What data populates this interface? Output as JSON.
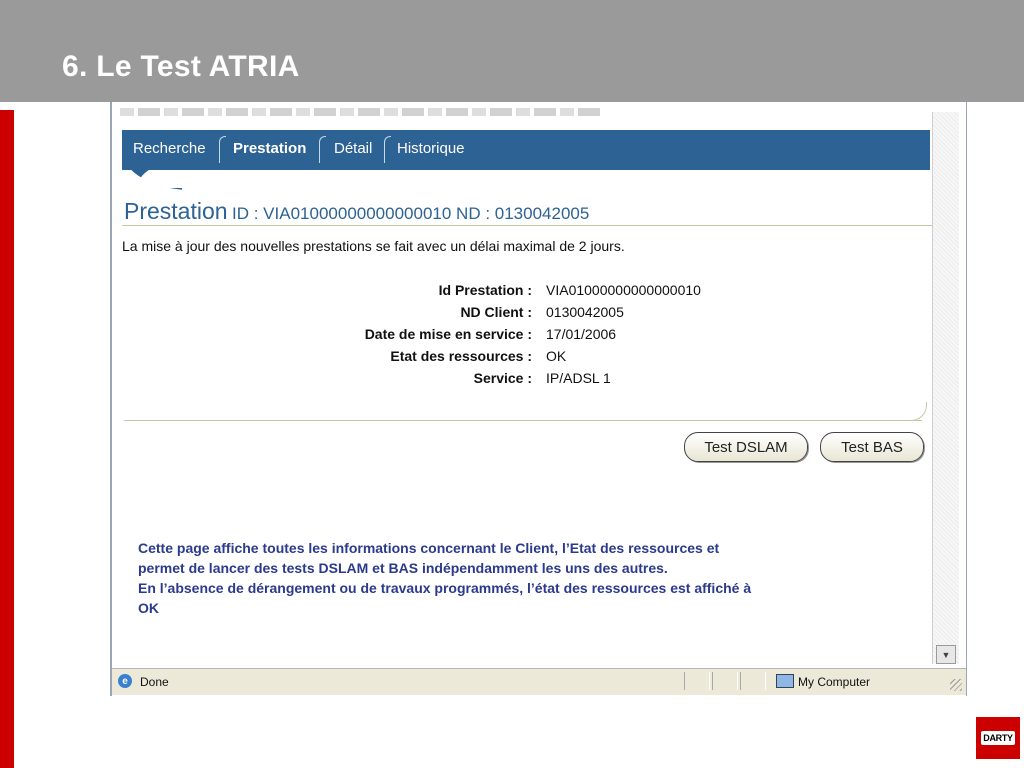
{
  "slide": {
    "title": "6. Le Test ATRIA"
  },
  "nav": {
    "tabs": [
      "Recherche",
      "Prestation",
      "Détail",
      "Historique"
    ],
    "active": "Prestation"
  },
  "page": {
    "title_main": "Prestation",
    "title_ids": "ID : VIA01000000000000010 ND : 0130042005",
    "info": "La mise à jour des nouvelles prestations se fait avec un délai maximal de 2 jours."
  },
  "fields": [
    {
      "label": "Id Prestation :",
      "value": "VIA01000000000000010"
    },
    {
      "label": "ND Client :",
      "value": "0130042005"
    },
    {
      "label": "Date de mise en service :",
      "value": "17/01/2006"
    },
    {
      "label": "Etat des ressources :",
      "value": "OK"
    },
    {
      "label": "Service :",
      "value": "IP/ADSL 1"
    }
  ],
  "buttons": {
    "dslam": "Test DSLAM",
    "bas": "Test BAS"
  },
  "annotation": {
    "line1": "Cette page affiche toutes les informations concernant le Client, l’Etat des ressources et",
    "line2": "permet de lancer des tests DSLAM et BAS indépendamment les  uns des autres.",
    "line3": "En l’absence de dérangement ou de travaux programmés, l’état des ressources  est affiché à",
    "line4": "OK"
  },
  "statusbar": {
    "status": "Done",
    "zone": "My Computer"
  },
  "logo": {
    "text": "DARTY"
  },
  "colors": {
    "header_gray": "#9a9a9a",
    "brand_red": "#cc0000",
    "nav_blue": "#2d6294",
    "annotation_blue": "#2b3a8c"
  }
}
